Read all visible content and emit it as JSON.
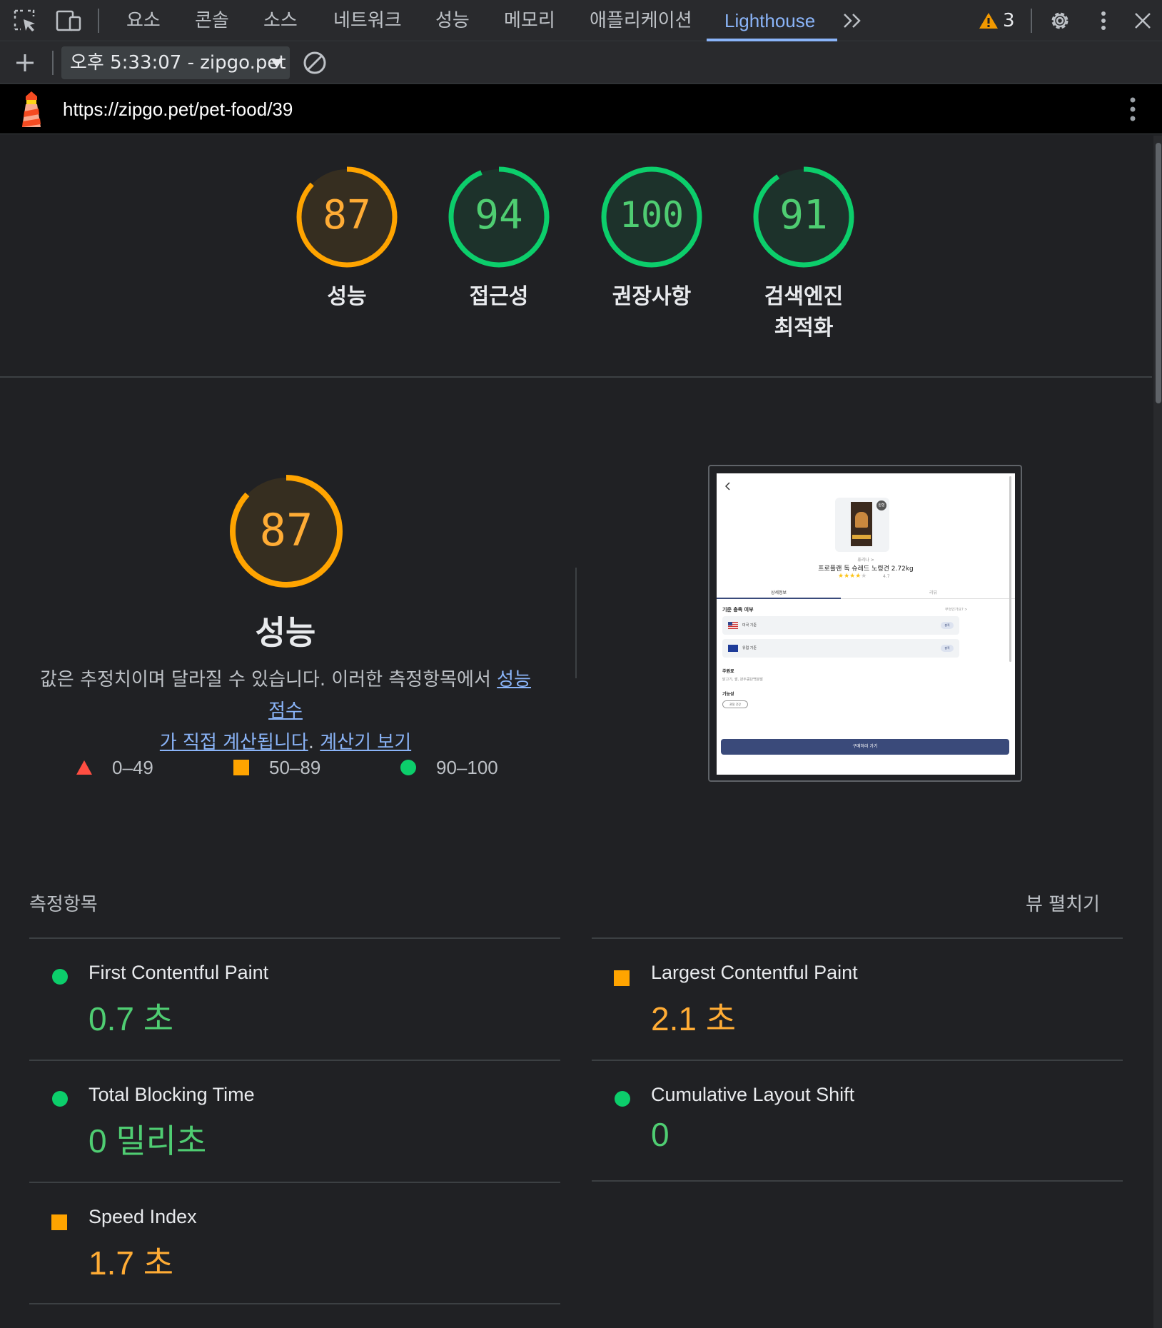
{
  "toolbar": {
    "tabs": [
      "요소",
      "콘솔",
      "소스",
      "네트워크",
      "성능",
      "메모리",
      "애플리케이션",
      "Lighthouse"
    ],
    "active_tab": "Lighthouse",
    "warning_count": "3"
  },
  "report_bar": {
    "selected_report": "오후 5:33:07 - zipgo.pet"
  },
  "url": "https://zipgo.pet/pet-food/39",
  "scores": [
    {
      "value": "87",
      "label": "성능",
      "fraction": 0.87,
      "status": "average"
    },
    {
      "value": "94",
      "label": "접근성",
      "fraction": 0.94,
      "status": "pass"
    },
    {
      "value": "100",
      "label": "권장사항",
      "fraction": 1.0,
      "status": "pass"
    },
    {
      "value": "91",
      "label_line1": "검색엔진",
      "label_line2": "최적화",
      "fraction": 0.91,
      "status": "pass"
    }
  ],
  "performance": {
    "score": "87",
    "fraction": 0.87,
    "title": "성능",
    "desc_text": "값은 추정치이며 달라질 수 있습니다. 이러한 측정항목에서 ",
    "desc_link1_part1": "성능 점수",
    "desc_link1_part2": "가 직접 계산됩니다",
    "desc_sep": ". ",
    "desc_link2": "계산기 보기"
  },
  "legend": [
    {
      "shape": "triangle",
      "range": "0–49",
      "color": "#ff4e42"
    },
    {
      "shape": "square",
      "range": "50–89",
      "color": "#ffa400"
    },
    {
      "shape": "circle",
      "range": "90–100",
      "color": "#0cce6b"
    }
  ],
  "thumbnail": {
    "product_badge": "원형",
    "product_brand": "퓨리나 >",
    "product_name": "프로플랜 독 슈레드 노령견 2.72kg",
    "rating": "4.7",
    "tab_detail": "상세정보",
    "tab_review": "리뷰",
    "section_criteria": "기준 충족 여부",
    "criteria_hint": "무엇인가요? >",
    "criteria_us": "미국 기준",
    "criteria_eu": "유럽 기준",
    "criteria_pass": "충족",
    "section_ingredients": "주원료",
    "ingredients_text": "닭고기, 쌀, 완두콩단백분말",
    "section_function": "기능성",
    "function_tag": "관절 건강",
    "buy_button": "구매하러 가기"
  },
  "metrics": {
    "title": "측정항목",
    "expand_label": "뷰 펼치기",
    "items": [
      {
        "name": "First Contentful Paint",
        "value": "0.7 초",
        "status": "pass"
      },
      {
        "name": "Largest Contentful Paint",
        "value": "2.1 초",
        "status": "average"
      },
      {
        "name": "Total Blocking Time",
        "value": "0 밀리초",
        "status": "pass"
      },
      {
        "name": "Cumulative Layout Shift",
        "value": "0",
        "status": "pass"
      },
      {
        "name": "Speed Index",
        "value": "1.7 초",
        "status": "average"
      }
    ]
  },
  "colors": {
    "pass": "#0cce6b",
    "pass_text": "#4fcd72",
    "average": "#ffa400",
    "average_text": "#ffac35",
    "fail": "#ff4e42",
    "link": "#8ab4f8",
    "accent_tab": "#8ab4f8"
  }
}
